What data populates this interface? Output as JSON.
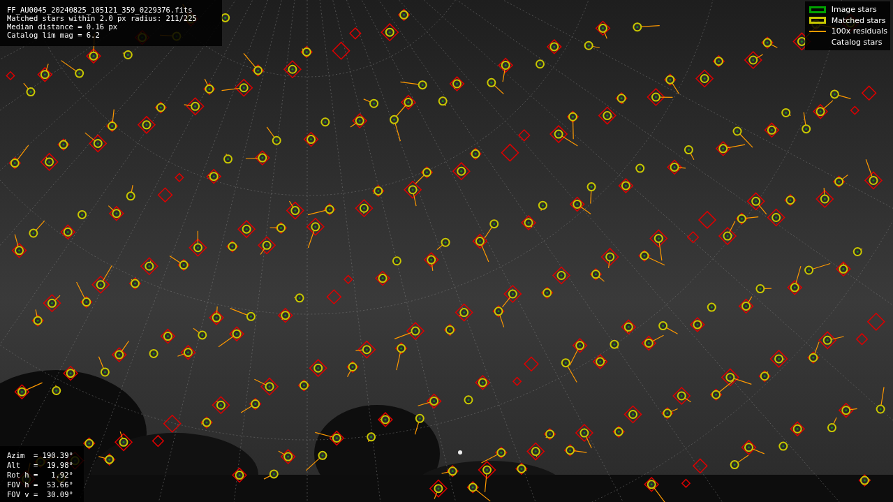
{
  "info": {
    "lines": [
      "FF_AU0045_20240825_105121_359_0229376.fits",
      "Matched stars within 2.0 px radius: 211/225",
      "Median distance = 0.16 px",
      "Catalog lim mag = 6.2"
    ]
  },
  "legend": [
    {
      "kind": "box",
      "label": "Image stars",
      "color": "#00a000"
    },
    {
      "kind": "box",
      "label": "Matched stars",
      "color": "#c8c800"
    },
    {
      "kind": "line",
      "label": "100x residuals",
      "color": "#ff9900"
    },
    {
      "kind": "none",
      "label": "Catalog stars"
    }
  ],
  "pointing": {
    "lines": [
      "Azim  = 190.39°",
      "Alt   =  19.98°",
      "Rot h =   1.92°",
      "FOV h =  53.66°",
      "FOV v =  30.09°"
    ]
  }
}
